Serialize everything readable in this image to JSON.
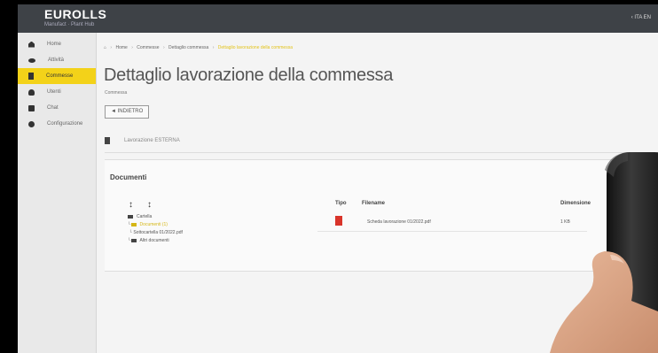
{
  "app": {
    "brand": "EUROLLS",
    "brand_sub": "Manufact · Plant Hub",
    "user": "‹ ITA EN"
  },
  "sidebar": {
    "items": [
      {
        "label": "Home",
        "icon": "home-icon",
        "active": false
      },
      {
        "label": "Attività",
        "icon": "wrench-icon",
        "active": false
      },
      {
        "label": "Commesse",
        "icon": "document-icon",
        "active": true
      },
      {
        "label": "Utenti",
        "icon": "people-icon",
        "active": false
      },
      {
        "label": "Chat",
        "icon": "chat-icon",
        "active": false
      },
      {
        "label": "Configurazione",
        "icon": "gear-icon",
        "active": false
      }
    ]
  },
  "breadcrumb": {
    "items": [
      "Home",
      "Commesse",
      "Dettaglio commessa"
    ],
    "current": "Dettaglio lavorazione della commessa"
  },
  "page": {
    "title": "Dettaglio lavorazione della commessa",
    "subtitle": "Commessa",
    "back_label": "◄ INDIETRO",
    "info_text": "Lavorazione ESTERNA"
  },
  "documents": {
    "title": "Documenti",
    "tree_controls": [
      "↕",
      "↕"
    ],
    "tree": [
      "Cartella",
      "Documenti (1)",
      "Sottocartella 01/2022.pdf",
      "Altri documenti"
    ],
    "columns": {
      "type": "Tipo",
      "filename": "Filename",
      "dimension": "Dimensione"
    },
    "rows": [
      {
        "filename": "Scheda lavorazione 01/2022.pdf",
        "dimension": "1 KB"
      }
    ]
  },
  "colors": {
    "topbar": "#3e4247",
    "accent": "#f3d219",
    "pdf": "#d9342a"
  }
}
